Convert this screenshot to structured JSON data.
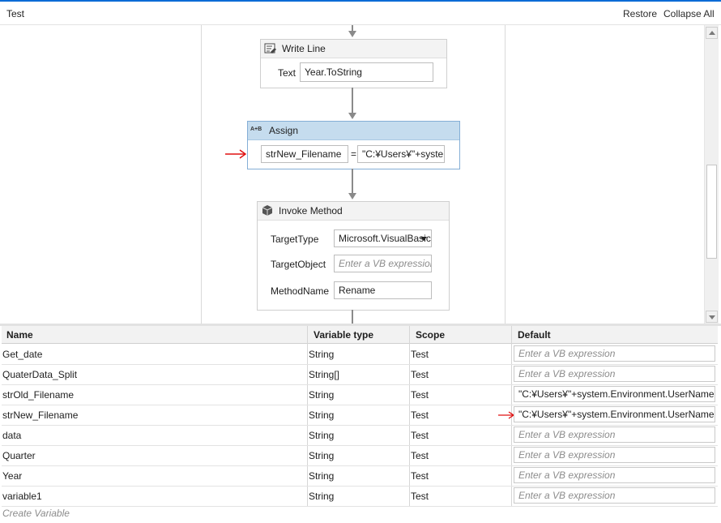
{
  "header": {
    "title": "Test",
    "restore_label": "Restore",
    "collapse_label": "Collapse All"
  },
  "workflow": {
    "write_line": {
      "title": "Write Line",
      "icon": "write-line-icon",
      "text_label": "Text",
      "text_value": "Year.ToString"
    },
    "assign": {
      "title": "Assign",
      "icon_text": "A+B",
      "to_value": "strNew_Filename",
      "equals": "=",
      "value": "\"C:¥Users¥\"+system.Environment.UserName+"
    },
    "invoke_method": {
      "title": "Invoke Method",
      "icon": "cube-icon",
      "target_type_label": "TargetType",
      "target_type_value": "Microsoft.VisualBasic.FileSystem",
      "target_object_label": "TargetObject",
      "target_object_placeholder": "Enter a VB expression",
      "method_name_label": "MethodName",
      "method_name_value": "Rename"
    }
  },
  "variables": {
    "headers": {
      "name": "Name",
      "type": "Variable type",
      "scope": "Scope",
      "default": "Default"
    },
    "rows": [
      {
        "name": "Get_date",
        "type": "String",
        "scope": "Test",
        "default": "Enter a VB expression",
        "is_placeholder": true
      },
      {
        "name": "QuaterData_Split",
        "type": "String[]",
        "scope": "Test",
        "default": "Enter a VB expression",
        "is_placeholder": true
      },
      {
        "name": "strOld_Filename",
        "type": "String",
        "scope": "Test",
        "default": "\"C:¥Users¥\"+system.Environment.UserName+\"",
        "is_placeholder": false
      },
      {
        "name": "strNew_Filename",
        "type": "String",
        "scope": "Test",
        "default": "\"C:¥Users¥\"+system.Environment.UserName+\"",
        "is_placeholder": false
      },
      {
        "name": "data",
        "type": "String",
        "scope": "Test",
        "default": "Enter a VB expression",
        "is_placeholder": true
      },
      {
        "name": "Quarter",
        "type": "String",
        "scope": "Test",
        "default": "Enter a VB expression",
        "is_placeholder": true
      },
      {
        "name": "Year",
        "type": "String",
        "scope": "Test",
        "default": "Enter a VB expression",
        "is_placeholder": true
      },
      {
        "name": "variable1",
        "type": "String",
        "scope": "Test",
        "default": "Enter a VB expression",
        "is_placeholder": true
      }
    ],
    "create_variable_label": "Create Variable"
  },
  "colors": {
    "accent": "#0b6bd6",
    "selected_header": "#c5dcee",
    "annotation_arrow": "#e01010"
  }
}
